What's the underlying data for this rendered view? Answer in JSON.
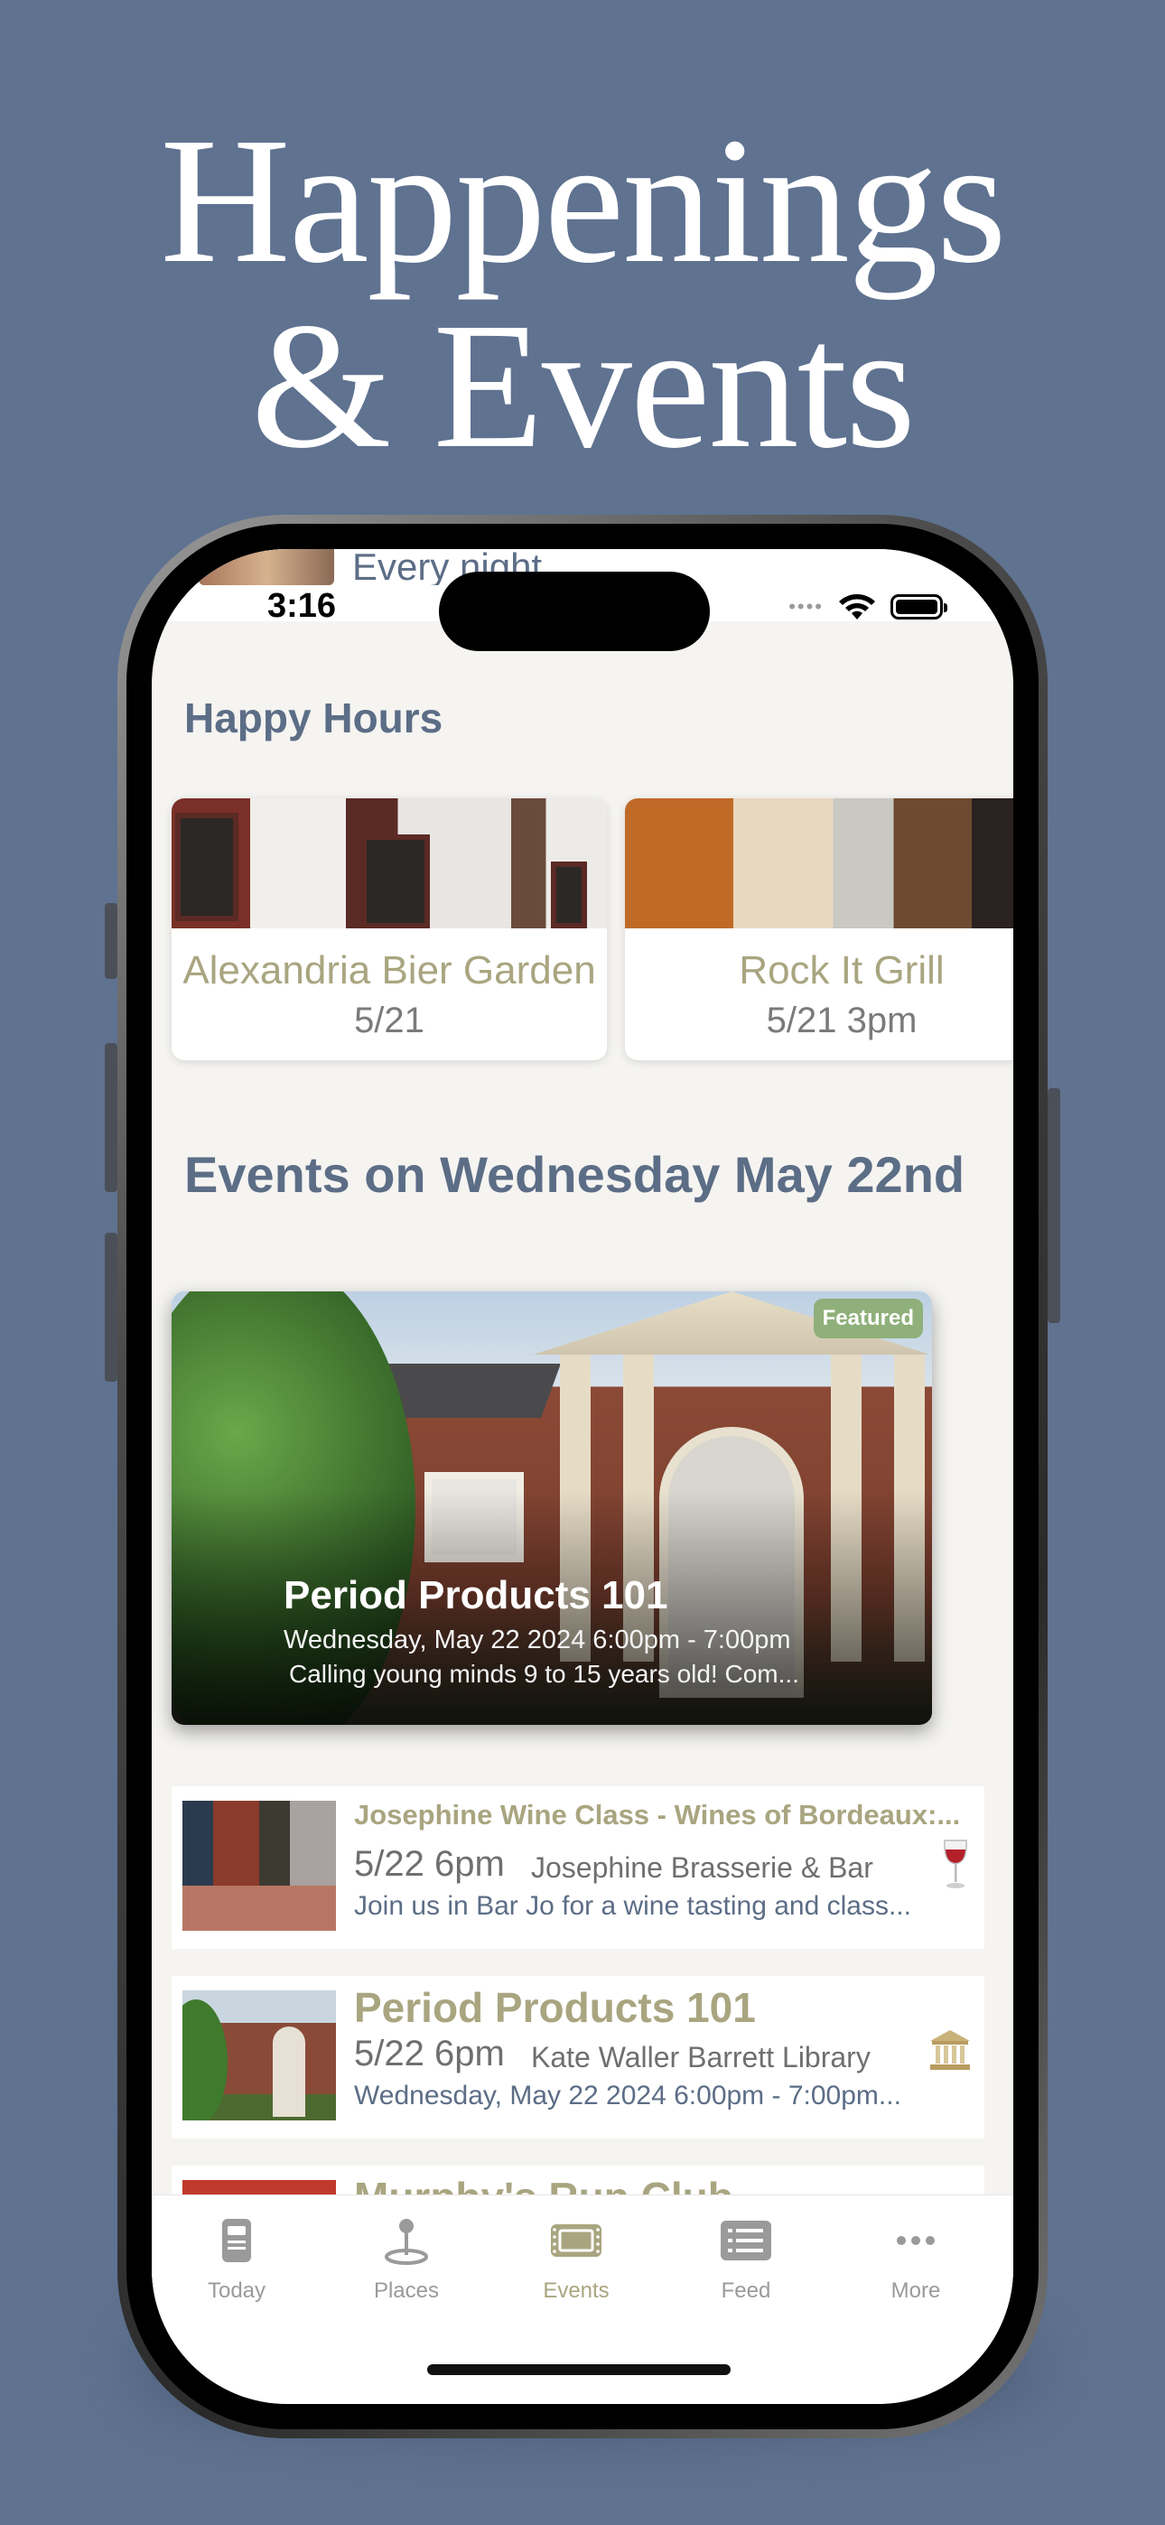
{
  "headline": {
    "line1": "Happenings",
    "line2": "& Events"
  },
  "status_bar": {
    "time": "3:16",
    "icons": [
      "cellular-icon",
      "wifi-icon",
      "battery-icon"
    ]
  },
  "peek": {
    "text": "Every night"
  },
  "happy_hours": {
    "title": "Happy Hours",
    "cards": [
      {
        "name": "Alexandria Bier Garden",
        "date": "5/21"
      },
      {
        "name": "Rock It Grill",
        "date": "5/21 3pm"
      }
    ]
  },
  "events": {
    "title": "Events on Wednesday May 22nd",
    "featured": {
      "badge": "Featured",
      "title": "Period Products 101",
      "date": "Wednesday, May 22 2024 6:00pm - 7:00pm",
      "description": "Calling young minds 9 to 15 years old! Com..."
    },
    "list": [
      {
        "title": "Josephine Wine Class - Wines of Bordeaux:...",
        "when": "5/22 6pm",
        "venue": "Josephine Brasserie & Bar",
        "description": "Join us in Bar Jo  for a wine tasting and class...",
        "icon": "wine-glass-icon"
      },
      {
        "title": "Period Products 101",
        "when": "5/22 6pm",
        "venue": "Kate Waller Barrett Library",
        "description": "Wednesday, May 22 2024 6:00pm - 7:00pm...",
        "icon": "museum-icon"
      },
      {
        "title": "Murphy's Run Club"
      }
    ]
  },
  "tab_bar": {
    "tabs": [
      {
        "label": "Today",
        "icon": "newspaper-icon"
      },
      {
        "label": "Places",
        "icon": "map-pin-icon"
      },
      {
        "label": "Events",
        "icon": "ticket-icon",
        "active": true
      },
      {
        "label": "Feed",
        "icon": "list-icon"
      },
      {
        "label": "More",
        "icon": "ellipsis-icon"
      }
    ]
  },
  "colors": {
    "background": "#5f7290",
    "accent": "#a9a580",
    "heading": "#5c6d86",
    "featured_badge": "#8fb07a"
  }
}
